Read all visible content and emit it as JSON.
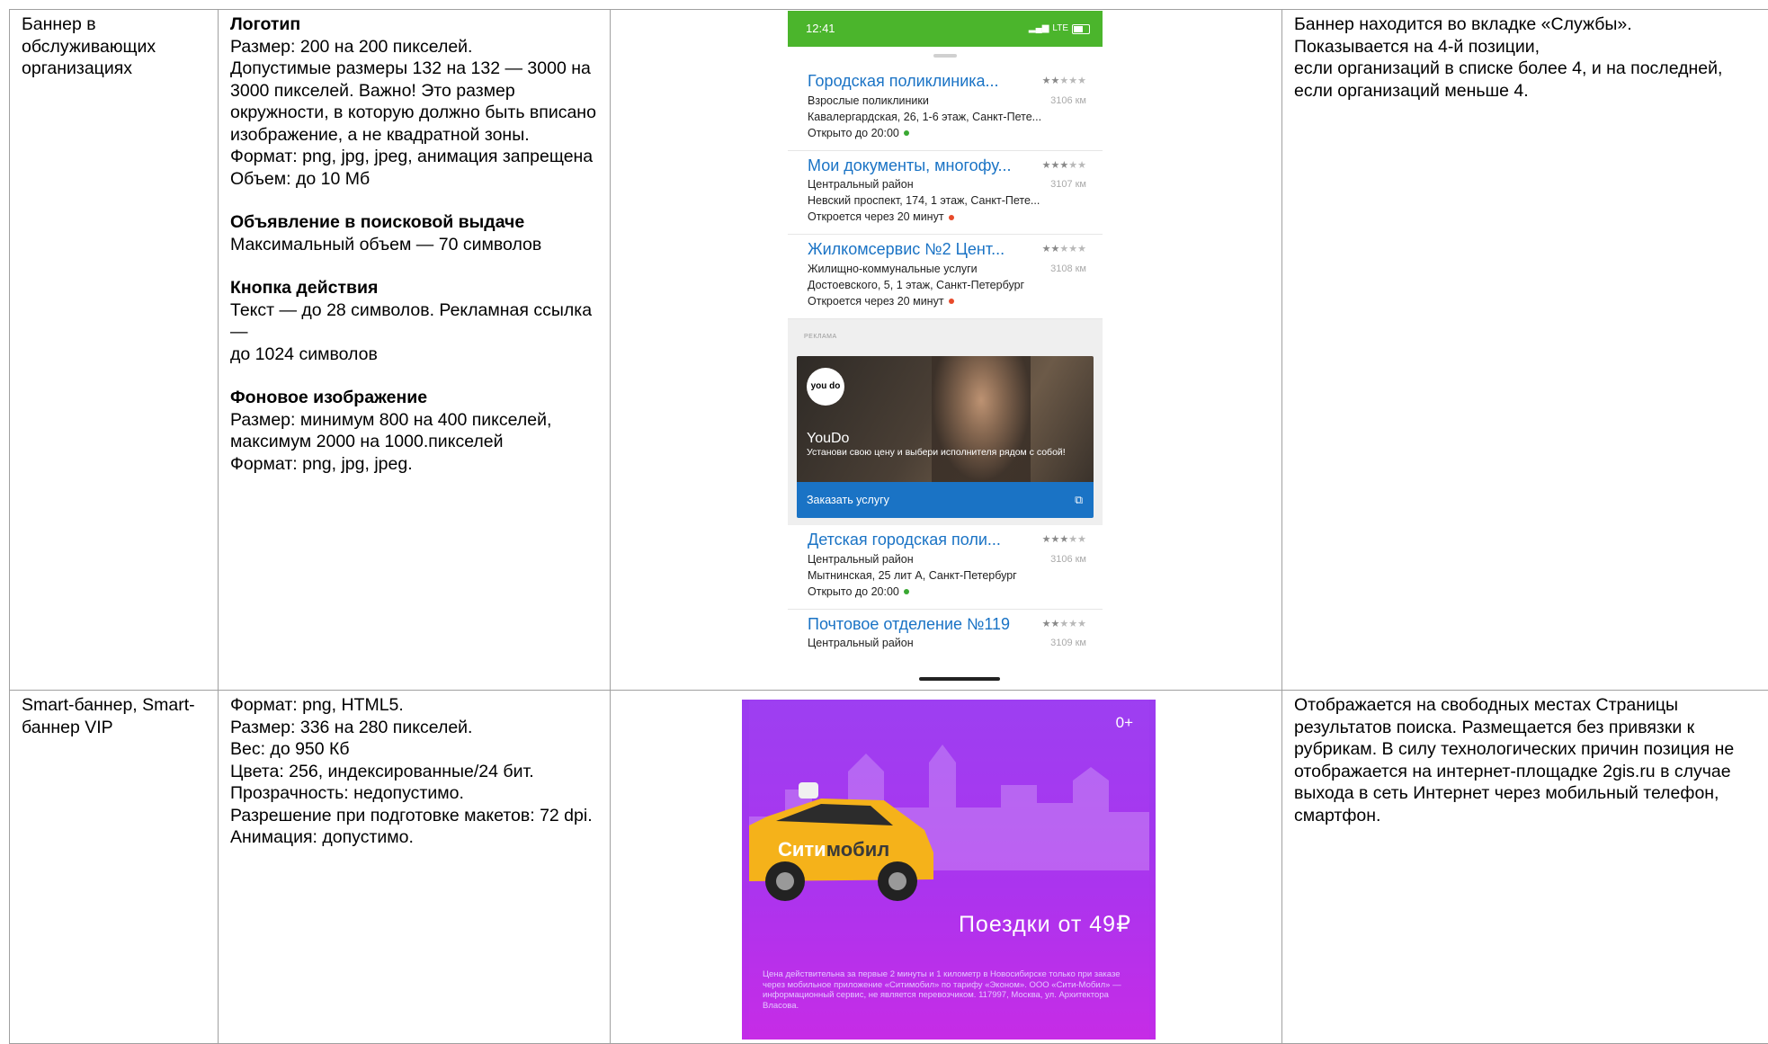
{
  "rows": [
    {
      "type": "Баннер в обслуживающих организациях",
      "spec": {
        "logo_title": "Логотип",
        "logo_lines": [
          "Размер: 200 на 200 пикселей.",
          "Допустимые размеры 132 на 132 — 3000 на 3000 пикселей. Важно! Это размер окружности, в которую должно быть вписано изображение, а не квадратной зоны.",
          "Формат: png, jpg, jpeg, анимация запрещена",
          "Объем: до 10 Мб"
        ],
        "ad_title": "Объявление в поисковой выдаче",
        "ad_line": "Максимальный объем — 70 символов",
        "button_title": "Кнопка действия",
        "button_lines": [
          "Текст — до 28 символов. Рекламная ссылка —",
          "до 1024 символов"
        ],
        "bg_title": "Фоновое изображение",
        "bg_lines": [
          "Размер: минимум 800 на 400 пикселей, максимум 2000 на 1000.пикселей",
          "Формат: png, jpg, jpeg."
        ]
      },
      "description": [
        "Баннер находится во вкладке «Службы».",
        "Показывается на 4-й позиции,",
        "если организаций в списке более 4, и на последней, если организаций меньше 4."
      ],
      "phone": {
        "time": "12:41",
        "network": "LTE",
        "orgs_before": [
          {
            "name": "Городская поликлиника...",
            "category": "Взрослые поликлиники",
            "distance": "3106 км",
            "address": "Кавалергардская, 26, 1-6 этаж, Санкт-Пете...",
            "hours": "Открыто до 20:00",
            "status": "open",
            "stars": "★★★★★",
            "rating_filled": 2
          },
          {
            "name": "Мои документы, многофу...",
            "category": "Центральный район",
            "distance": "3107 км",
            "address": "Невский проспект, 174, 1 этаж, Санкт-Пете...",
            "hours": "Откроется через 20 минут",
            "status": "closed",
            "stars": "★★★★★",
            "rating_filled": 3
          },
          {
            "name": "Жилкомсервис №2 Цент...",
            "category": "Жилищно-коммунальные услуги",
            "distance": "3108 км",
            "address": "Достоевского, 5, 1 этаж, Санкт-Петербург",
            "hours": "Откроется через 20 минут",
            "status": "closed",
            "stars": "★★★★★",
            "rating_filled": 2
          }
        ],
        "ad": {
          "label": "РЕКЛАМА",
          "logo": "you do",
          "title": "YouDo",
          "text": "Установи свою цену и выбери исполнителя рядом с собой!",
          "button": "Заказать услугу",
          "button_icon": "external-link-icon"
        },
        "orgs_after": [
          {
            "name": "Детская городская поли...",
            "category": "Центральный район",
            "distance": "3106 км",
            "address": "Мытнинская, 25 лит А, Санкт-Петербург",
            "hours": "Открыто до 20:00",
            "status": "open",
            "stars": "★★★★★",
            "rating_filled": 3
          },
          {
            "name": "Почтовое отделение №119",
            "category": "Центральный район",
            "distance": "3109 км",
            "address": "",
            "hours": "",
            "status": "",
            "stars": "★★★★★",
            "rating_filled": 2
          }
        ]
      }
    },
    {
      "type": "Smart-баннер, Smart-баннер VIP",
      "spec_lines": [
        "Формат: png, HTML5.",
        "Размер: 336 на 280 пикселей.",
        "Вес: до 950 Кб",
        "Цвета: 256, индексированные/24 бит.",
        "Прозрачность: недопустимо.",
        "Разрешение при подготовке макетов: 72 dpi.",
        "Анимация: допустимо."
      ],
      "description": "Отображается на свободных местах Страницы результатов поиска. Размещается без привязки к рубрикам. В силу технологических причин позиция не отображается на интернет-площадке 2gis.ru в случае выхода в сеть Интернет через мобильный телефон, смартфон.",
      "banner": {
        "age": "0+",
        "brand_part1": "Сити",
        "brand_part2": "мобил",
        "promo": "Поездки от 49₽",
        "legal": "Цена действительна за первые 2 минуты и 1 километр в Новосибирске только при заказе через мобильное приложение «Ситимобил» по тарифу «Эконом». ООО «Сити-Мобил» — информационный сервис, не является перевозчиком. 117997, Москва, ул. Архитектора Власова."
      }
    }
  ]
}
